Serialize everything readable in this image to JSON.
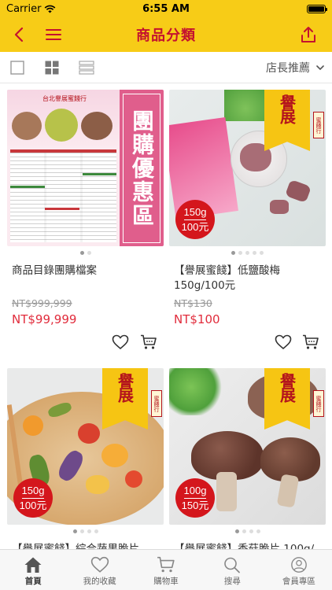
{
  "status_bar": {
    "carrier": "Carrier",
    "time": "6:55 AM"
  },
  "nav": {
    "title": "商品分類",
    "back_icon": "chevron-left-icon",
    "menu_icon": "hamburger-icon",
    "share_icon": "share-icon"
  },
  "filter": {
    "sort_label": "店長推薦"
  },
  "products": [
    {
      "name": "商品目錄團購檔案",
      "old_price": "NT$999,999",
      "price": "NT$99,999",
      "promo_title": "台北譽展蜜餞行",
      "promo_vertical": "團購優惠區"
    },
    {
      "name": "【譽展蜜餞】低鹽酸梅 150g/100元",
      "old_price": "NT$130",
      "price": "NT$100",
      "badge_weight": "150g",
      "badge_price": "100元",
      "brand": "譽展",
      "seal": "蜜餞行"
    },
    {
      "name": "【譽展蜜餞】綜合蔬果脆片",
      "badge_weight": "150g",
      "badge_price": "100元",
      "brand": "譽展",
      "seal": "蜜餞行"
    },
    {
      "name": "【譽展蜜餞】香菇脆片 100g/",
      "badge_weight": "100g",
      "badge_price": "150元",
      "brand": "譽展",
      "seal": "蜜餞行"
    }
  ],
  "tabs": [
    {
      "label": "首頁",
      "icon": "home-icon"
    },
    {
      "label": "我的收藏",
      "icon": "heart-icon"
    },
    {
      "label": "購物車",
      "icon": "cart-icon"
    },
    {
      "label": "搜尋",
      "icon": "search-icon"
    },
    {
      "label": "會員專區",
      "icon": "user-icon"
    }
  ],
  "colors": {
    "brand_yellow": "#f7cc17",
    "title_red": "#c4122f",
    "price_red": "#e12c3c"
  }
}
